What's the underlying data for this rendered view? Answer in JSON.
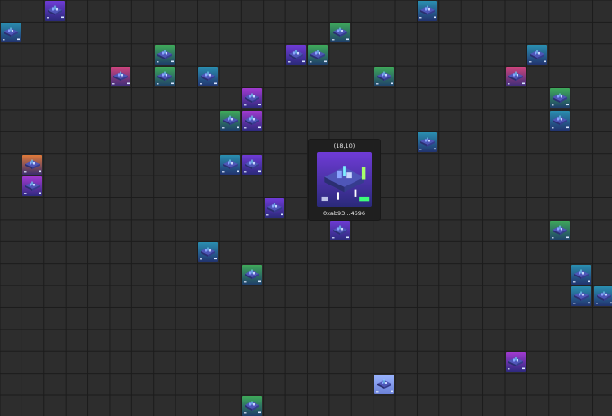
{
  "grid": {
    "columns": 28,
    "rows": 19,
    "line_color": "#1b1b1b",
    "cell_color": "#2d2d2d"
  },
  "parcels": [
    {
      "col": 2,
      "row": 0,
      "theme": "violet"
    },
    {
      "col": 19,
      "row": 0,
      "theme": "cyan"
    },
    {
      "col": 0,
      "row": 1,
      "theme": "cyan"
    },
    {
      "col": 15,
      "row": 1,
      "theme": "green"
    },
    {
      "col": 7,
      "row": 2,
      "theme": "green"
    },
    {
      "col": 13,
      "row": 2,
      "theme": "violet"
    },
    {
      "col": 14,
      "row": 2,
      "theme": "green"
    },
    {
      "col": 24,
      "row": 2,
      "theme": "cyan"
    },
    {
      "col": 5,
      "row": 3,
      "theme": "pink"
    },
    {
      "col": 7,
      "row": 3,
      "theme": "green"
    },
    {
      "col": 9,
      "row": 3,
      "theme": "cyan"
    },
    {
      "col": 17,
      "row": 3,
      "theme": "green"
    },
    {
      "col": 23,
      "row": 3,
      "theme": "pink"
    },
    {
      "col": 11,
      "row": 4,
      "theme": "magenta"
    },
    {
      "col": 25,
      "row": 4,
      "theme": "green"
    },
    {
      "col": 10,
      "row": 5,
      "theme": "green"
    },
    {
      "col": 11,
      "row": 5,
      "theme": "magenta"
    },
    {
      "col": 25,
      "row": 5,
      "theme": "cyan"
    },
    {
      "col": 19,
      "row": 6,
      "theme": "cyan"
    },
    {
      "col": 1,
      "row": 7,
      "theme": "orange"
    },
    {
      "col": 10,
      "row": 7,
      "theme": "cyan"
    },
    {
      "col": 11,
      "row": 7,
      "theme": "violet"
    },
    {
      "col": 1,
      "row": 8,
      "theme": "magenta"
    },
    {
      "col": 12,
      "row": 9,
      "theme": "violet"
    },
    {
      "col": 15,
      "row": 10,
      "theme": "violet"
    },
    {
      "col": 25,
      "row": 10,
      "theme": "green"
    },
    {
      "col": 9,
      "row": 11,
      "theme": "cyan"
    },
    {
      "col": 11,
      "row": 12,
      "theme": "green"
    },
    {
      "col": 26,
      "row": 12,
      "theme": "cyan"
    },
    {
      "col": 26,
      "row": 13,
      "theme": "cyan"
    },
    {
      "col": 27,
      "row": 13,
      "theme": "cyan"
    },
    {
      "col": 23,
      "row": 16,
      "theme": "magenta"
    },
    {
      "col": 17,
      "row": 17,
      "theme": "light"
    },
    {
      "col": 11,
      "row": 18,
      "theme": "green"
    }
  ],
  "themes": {
    "violet": {
      "top": "#6f3bd6",
      "bottom": "#2a2a7a"
    },
    "cyan": {
      "top": "#2a8fb0",
      "bottom": "#22336e"
    },
    "green": {
      "top": "#3faa5a",
      "bottom": "#1f3e6a"
    },
    "pink": {
      "top": "#d0457d",
      "bottom": "#3a2d7a"
    },
    "magenta": {
      "top": "#a13ad0",
      "bottom": "#2d2a7e"
    },
    "orange": {
      "top": "#e07a3a",
      "bottom": "#3a2d6e"
    },
    "light": {
      "top": "#9ab4ff",
      "bottom": "#6a80d6"
    }
  },
  "popup": {
    "coords": "(18,10)",
    "owner": "0xab93...4696",
    "theme": "violet"
  }
}
